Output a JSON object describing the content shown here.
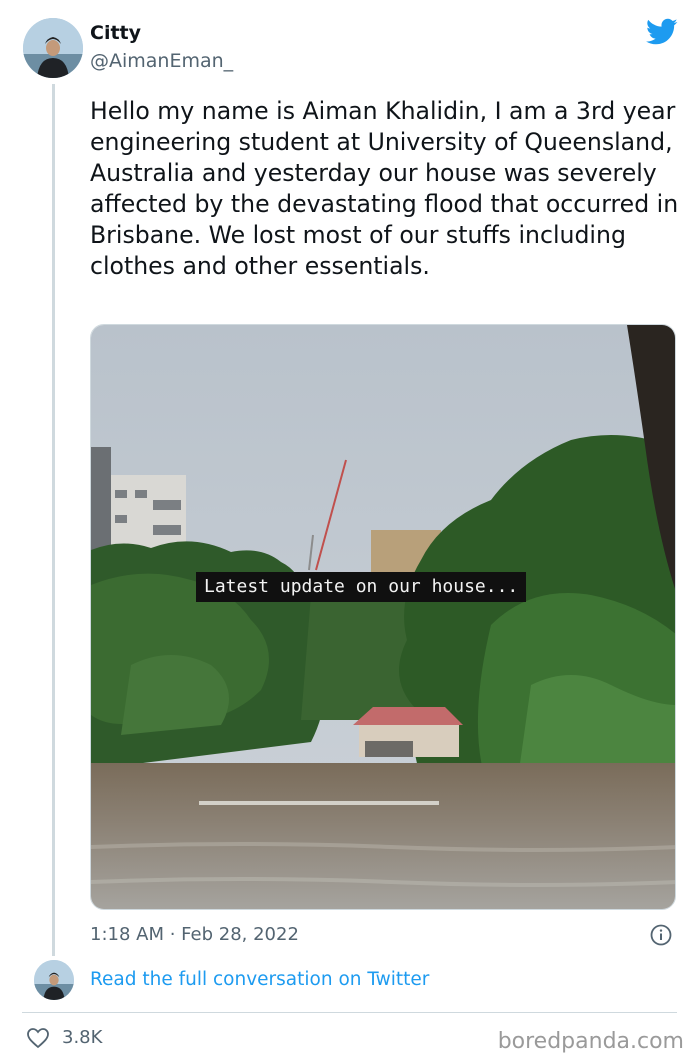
{
  "tweet": {
    "author_name": "Citty",
    "author_handle": "@AimanEman_",
    "text": "Hello my name is Aiman Khalidin, I am a 3rd year engineering student at University of Queensland, Australia and yesterday our house was severely affected by the devastating flood that occurred in Brisbane. We lost most of our stuffs including clothes and other essentials.",
    "media_caption": "Latest update on our house...",
    "timestamp": "1:18 AM · Feb 28, 2022",
    "read_more": "Read the full conversation on Twitter",
    "likes": "3.8K"
  },
  "watermark": "boredpanda.com",
  "icons": {
    "brand": "twitter-bird-icon",
    "info": "info-icon",
    "like": "heart-icon"
  },
  "colors": {
    "link": "#1d9bf0",
    "secondary_text": "#536471",
    "thread_line": "#cfd9de"
  }
}
